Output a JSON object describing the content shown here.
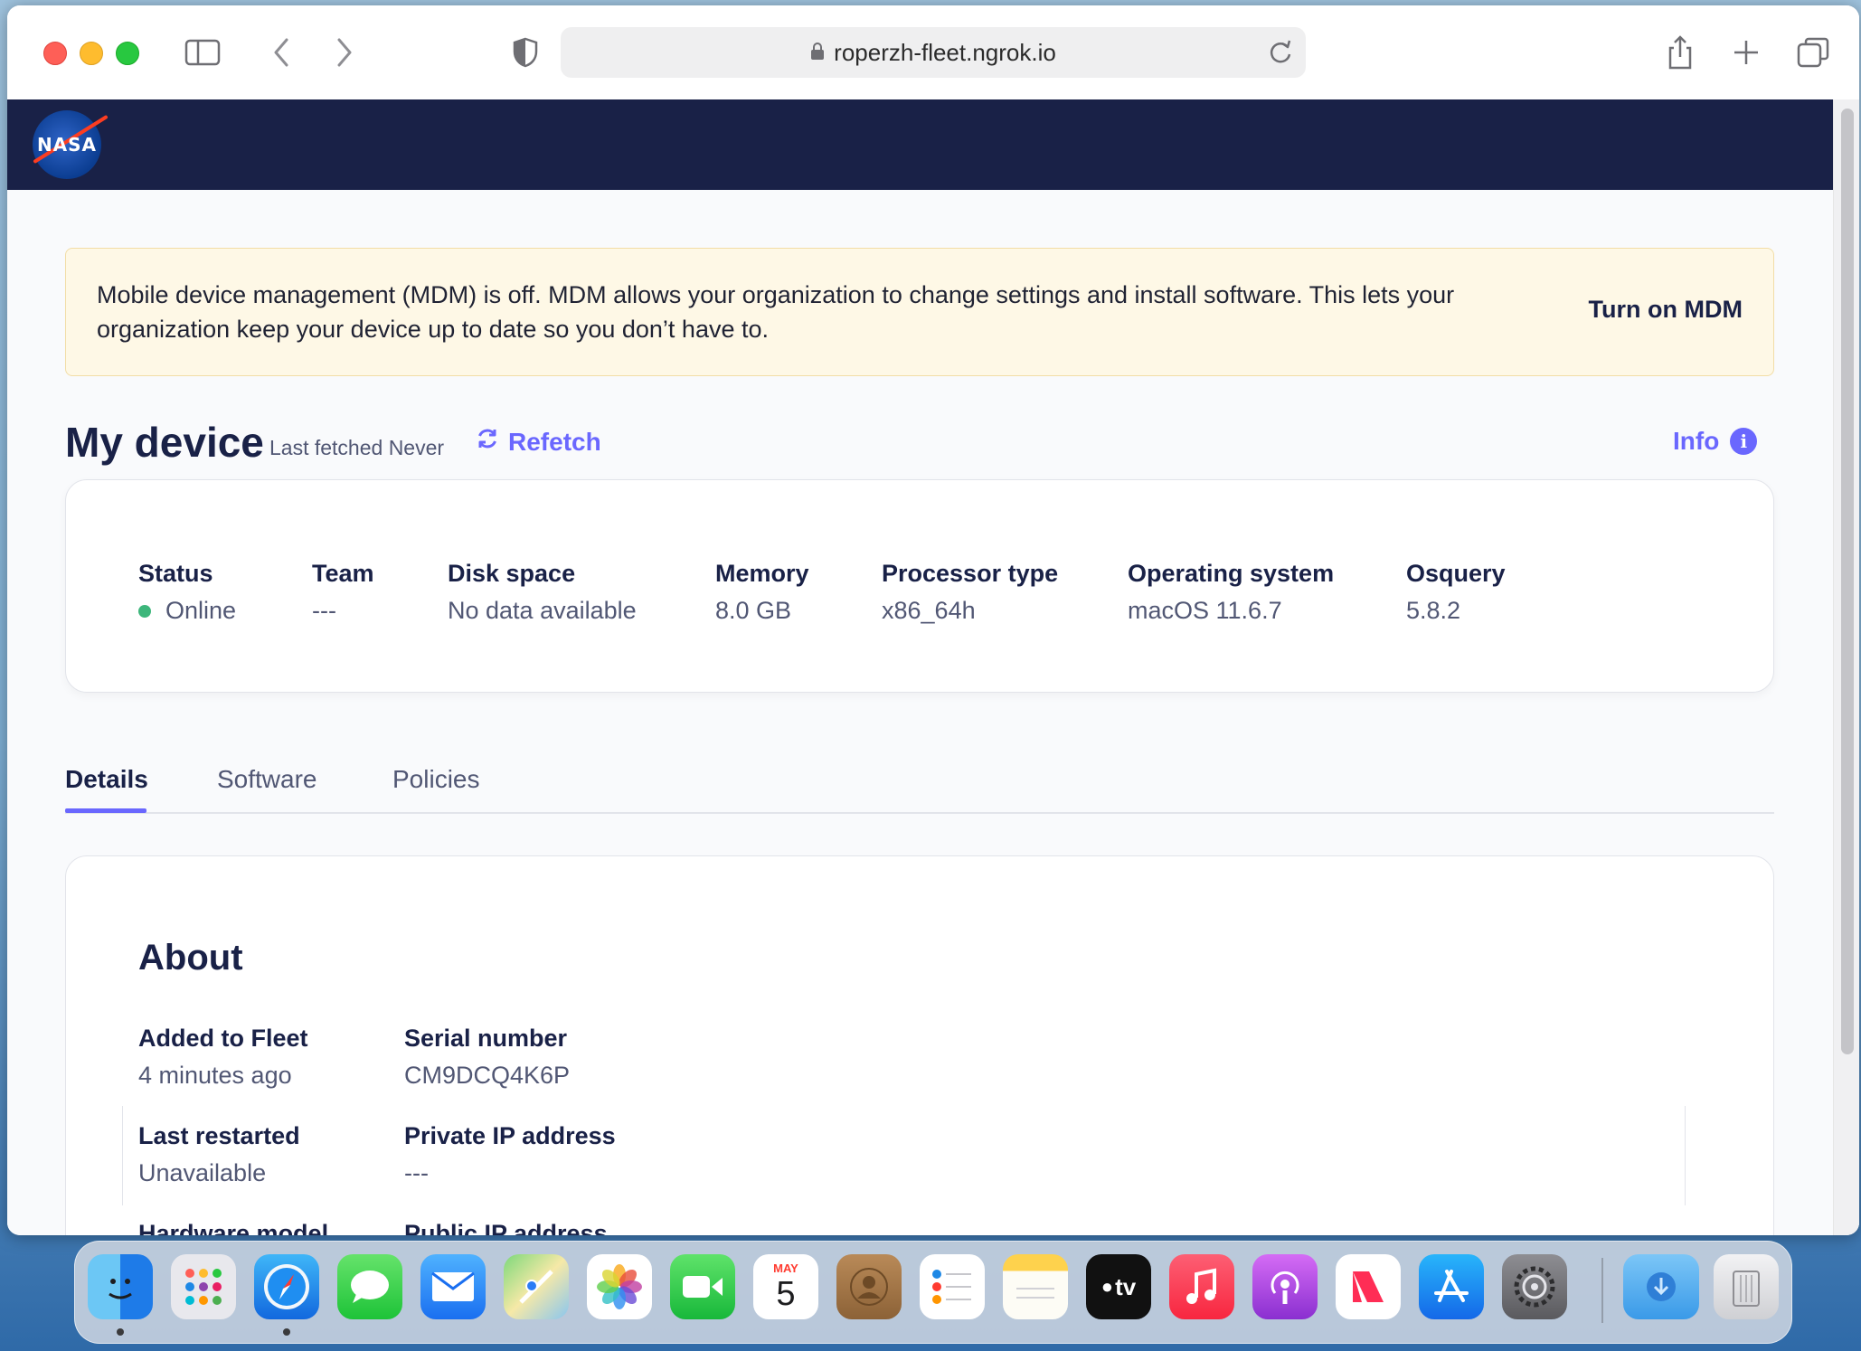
{
  "browser": {
    "url": "roperzh-fleet.ngrok.io"
  },
  "navbar": {
    "logo_text": "NASA"
  },
  "banner": {
    "message": "Mobile device management (MDM) is off. MDM allows your organization to change settings and install software. This lets your organization keep your device up to date so you don’t have to.",
    "button_label": "Turn on MDM"
  },
  "header": {
    "title": "My device",
    "last_fetched": "Last fetched Never",
    "refetch_label": "Refetch",
    "info_label": "Info"
  },
  "summary": {
    "status_label": "Status",
    "status_value": "Online",
    "team_label": "Team",
    "team_value": "---",
    "disk_label": "Disk space",
    "disk_value": "No data available",
    "memory_label": "Memory",
    "memory_value": "8.0 GB",
    "processor_label": "Processor type",
    "processor_value": "x86_64h",
    "os_label": "Operating system",
    "os_value": "macOS 11.6.7",
    "osquery_label": "Osquery",
    "osquery_value": "5.8.2"
  },
  "tabs": [
    {
      "label": "Details"
    },
    {
      "label": "Software"
    },
    {
      "label": "Policies"
    }
  ],
  "about": {
    "title": "About",
    "added_label": "Added to Fleet",
    "added_value": "4 minutes ago",
    "serial_label": "Serial number",
    "serial_value": "CM9DCQ4K6P",
    "restarted_label": "Last restarted",
    "restarted_value": "Unavailable",
    "private_ip_label": "Private IP address",
    "private_ip_value": "---",
    "hardware_label": "Hardware model",
    "public_ip_label": "Public IP address"
  },
  "dock": {
    "calendar_month": "MAY",
    "calendar_day": "5",
    "tv_label": "tv"
  },
  "colors": {
    "navbar": "#192147",
    "accent": "#6a67fe",
    "banner_bg": "#fef8e6",
    "online": "#3db67b"
  }
}
